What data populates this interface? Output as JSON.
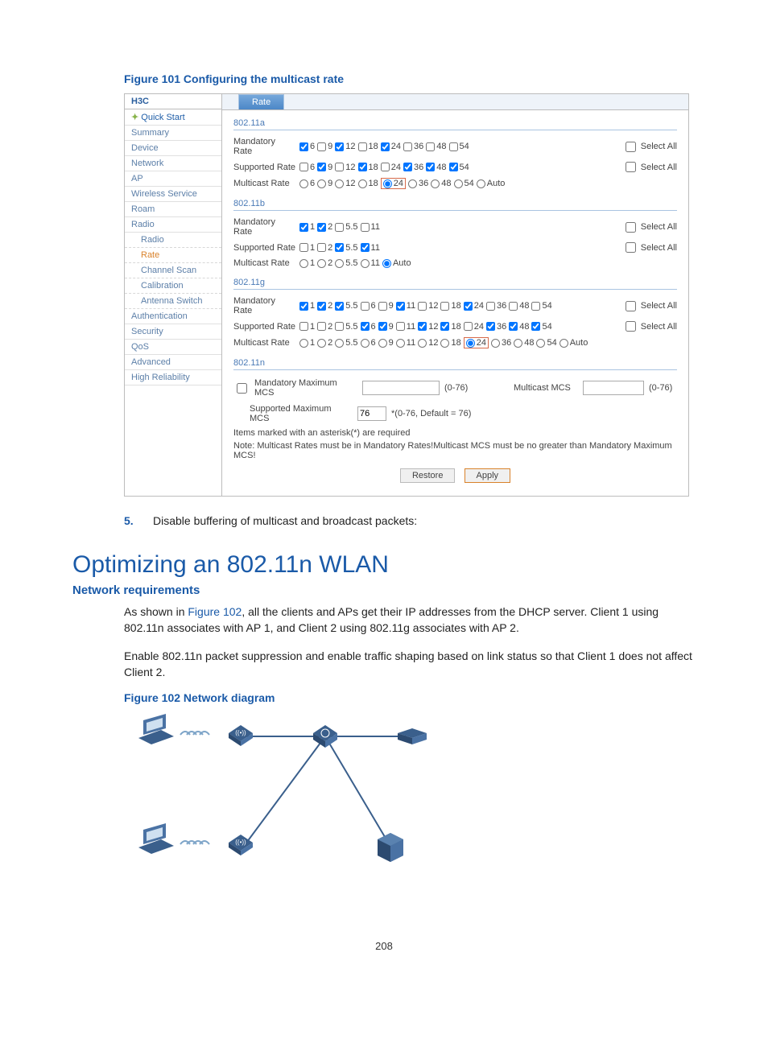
{
  "figure101_caption": "Figure 101 Configuring the multicast rate",
  "app": {
    "brand": "H3C",
    "sidebar": [
      {
        "label": "Quick Start",
        "cls": "quick",
        "interact": true
      },
      {
        "label": "Summary",
        "interact": true
      },
      {
        "label": "Device",
        "interact": true
      },
      {
        "label": "Network",
        "interact": true
      },
      {
        "label": "AP",
        "interact": true
      },
      {
        "label": "Wireless Service",
        "interact": true
      },
      {
        "label": "Roam",
        "interact": true
      },
      {
        "label": "Radio",
        "interact": true
      },
      {
        "label": "Radio",
        "sub": true,
        "interact": true
      },
      {
        "label": "Rate",
        "sub": true,
        "subrate": true,
        "interact": true
      },
      {
        "label": "Channel Scan",
        "sub": true,
        "interact": true
      },
      {
        "label": "Calibration",
        "sub": true,
        "interact": true
      },
      {
        "label": "Antenna Switch",
        "sub": true,
        "interact": true
      },
      {
        "label": "Authentication",
        "interact": true
      },
      {
        "label": "Security",
        "interact": true
      },
      {
        "label": "QoS",
        "interact": true
      },
      {
        "label": "Advanced",
        "interact": true
      },
      {
        "label": "High Reliability",
        "interact": true
      }
    ],
    "tab": "Rate",
    "sections": [
      {
        "title": "802.11a",
        "rows": [
          {
            "label": "Mandatory Rate",
            "type": "checkbox",
            "selectAll": true,
            "options": [
              {
                "v": "6",
                "c": true
              },
              {
                "v": "9",
                "c": false
              },
              {
                "v": "12",
                "c": true
              },
              {
                "v": "18",
                "c": false
              },
              {
                "v": "24",
                "c": true
              },
              {
                "v": "36",
                "c": false
              },
              {
                "v": "48",
                "c": false
              },
              {
                "v": "54",
                "c": false
              }
            ]
          },
          {
            "label": "Supported Rate",
            "type": "checkbox",
            "selectAll": true,
            "options": [
              {
                "v": "6",
                "c": false
              },
              {
                "v": "9",
                "c": true
              },
              {
                "v": "12",
                "c": false
              },
              {
                "v": "18",
                "c": true
              },
              {
                "v": "24",
                "c": false
              },
              {
                "v": "36",
                "c": true
              },
              {
                "v": "48",
                "c": true
              },
              {
                "v": "54",
                "c": true
              }
            ]
          },
          {
            "label": "Multicast Rate",
            "type": "radio",
            "selectAll": false,
            "options": [
              {
                "v": "6",
                "c": false
              },
              {
                "v": "9",
                "c": false
              },
              {
                "v": "12",
                "c": false
              },
              {
                "v": "18",
                "c": false
              },
              {
                "v": "24",
                "c": true,
                "hl": true
              },
              {
                "v": "36",
                "c": false
              },
              {
                "v": "48",
                "c": false
              },
              {
                "v": "54",
                "c": false
              },
              {
                "v": "Auto",
                "c": false
              }
            ]
          }
        ]
      },
      {
        "title": "802.11b",
        "rows": [
          {
            "label": "Mandatory Rate",
            "type": "checkbox",
            "selectAll": true,
            "options": [
              {
                "v": "1",
                "c": true
              },
              {
                "v": "2",
                "c": true
              },
              {
                "v": "5.5",
                "c": false
              },
              {
                "v": "11",
                "c": false
              }
            ]
          },
          {
            "label": "Supported Rate",
            "type": "checkbox",
            "selectAll": true,
            "options": [
              {
                "v": "1",
                "c": false
              },
              {
                "v": "2",
                "c": false
              },
              {
                "v": "5.5",
                "c": true
              },
              {
                "v": "11",
                "c": true
              }
            ]
          },
          {
            "label": "Multicast Rate",
            "type": "radio",
            "selectAll": false,
            "options": [
              {
                "v": "1",
                "c": false
              },
              {
                "v": "2",
                "c": false
              },
              {
                "v": "5.5",
                "c": false
              },
              {
                "v": "11",
                "c": false
              },
              {
                "v": "Auto",
                "c": true
              }
            ]
          }
        ]
      },
      {
        "title": "802.11g",
        "rows": [
          {
            "label": "Mandatory Rate",
            "type": "checkbox",
            "selectAll": true,
            "options": [
              {
                "v": "1",
                "c": true
              },
              {
                "v": "2",
                "c": true
              },
              {
                "v": "5.5",
                "c": true
              },
              {
                "v": "6",
                "c": false
              },
              {
                "v": "9",
                "c": false
              },
              {
                "v": "11",
                "c": true
              },
              {
                "v": "12",
                "c": false
              },
              {
                "v": "18",
                "c": false
              },
              {
                "v": "24",
                "c": true
              },
              {
                "v": "36",
                "c": false
              },
              {
                "v": "48",
                "c": false
              },
              {
                "v": "54",
                "c": false
              }
            ]
          },
          {
            "label": "Supported Rate",
            "type": "checkbox",
            "selectAll": true,
            "options": [
              {
                "v": "1",
                "c": false
              },
              {
                "v": "2",
                "c": false
              },
              {
                "v": "5.5",
                "c": false
              },
              {
                "v": "6",
                "c": true
              },
              {
                "v": "9",
                "c": true
              },
              {
                "v": "11",
                "c": false
              },
              {
                "v": "12",
                "c": true
              },
              {
                "v": "18",
                "c": true
              },
              {
                "v": "24",
                "c": false
              },
              {
                "v": "36",
                "c": true
              },
              {
                "v": "48",
                "c": true
              },
              {
                "v": "54",
                "c": true
              }
            ]
          },
          {
            "label": "Multicast Rate",
            "type": "radio",
            "selectAll": false,
            "options": [
              {
                "v": "1",
                "c": false
              },
              {
                "v": "2",
                "c": false
              },
              {
                "v": "5.5",
                "c": false
              },
              {
                "v": "6",
                "c": false
              },
              {
                "v": "9",
                "c": false
              },
              {
                "v": "11",
                "c": false
              },
              {
                "v": "12",
                "c": false
              },
              {
                "v": "18",
                "c": false
              },
              {
                "v": "24",
                "c": true,
                "hl": true
              },
              {
                "v": "36",
                "c": false
              },
              {
                "v": "48",
                "c": false
              },
              {
                "v": "54",
                "c": false
              },
              {
                "v": "Auto",
                "c": false
              }
            ]
          }
        ]
      }
    ],
    "section_n": {
      "title": "802.11n",
      "mandatory_chk": false,
      "mandatory_label": "Mandatory Maximum MCS",
      "mandatory_value": "",
      "mandatory_range": "(0-76)",
      "multicast_label": "Multicast MCS",
      "multicast_value": "",
      "multicast_range": "(0-76)",
      "supported_label": "Supported Maximum MCS",
      "supported_value": "76",
      "supported_range": "*(0-76, Default = 76)"
    },
    "note1": "Items marked with an asterisk(*) are required",
    "note2": "Note: Multicast Rates must be in Mandatory Rates!Multicast MCS must be no greater than Mandatory Maximum MCS!",
    "btn_restore": "Restore",
    "btn_apply": "Apply",
    "select_all": "Select All"
  },
  "step5_num": "5.",
  "step5_text": "Disable buffering of multicast and broadcast packets:",
  "h1": "Optimizing an 802.11n WLAN",
  "h2": "Network requirements",
  "para1a": "As shown in ",
  "para1link": "Figure 102",
  "para1b": ", all the clients and APs get their IP addresses from the DHCP server. Client 1 using 802.11n associates with AP 1, and Client 2 using 802.11g associates with AP 2.",
  "para2": "Enable 802.11n packet suppression and enable traffic shaping based on link status so that Client 1 does not affect Client 2.",
  "figure102_caption": "Figure 102 Network diagram",
  "pagenum": "208"
}
